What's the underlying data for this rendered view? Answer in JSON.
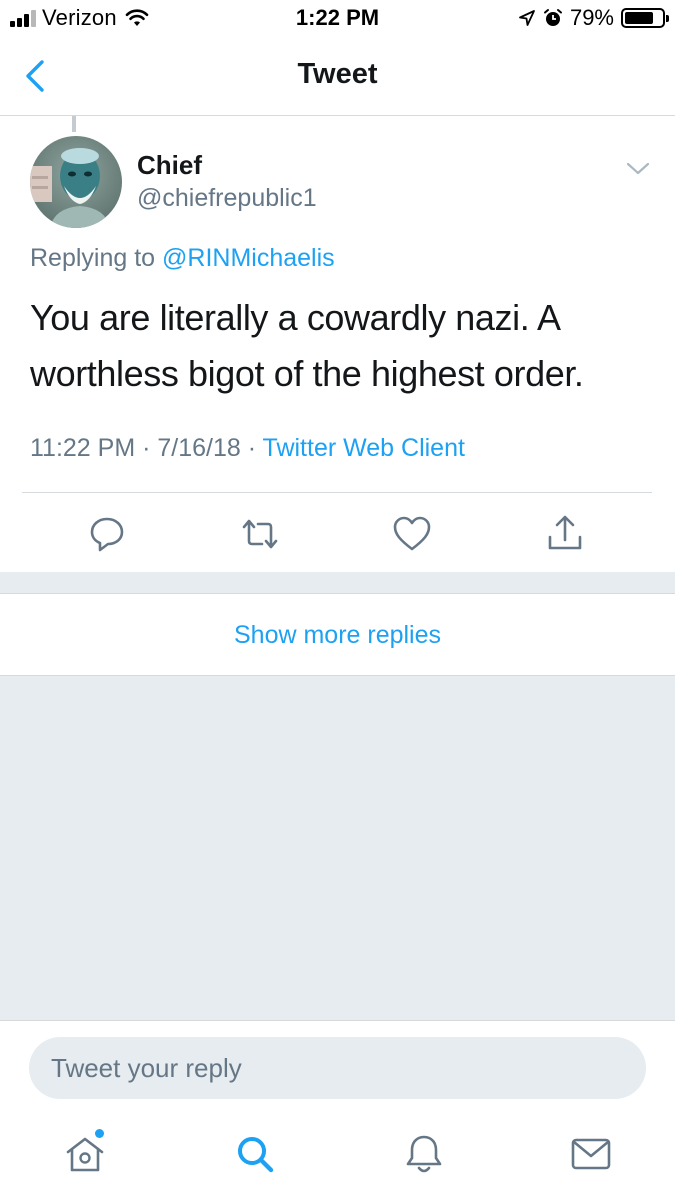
{
  "status_bar": {
    "carrier": "Verizon",
    "time": "1:22 PM",
    "battery_percent_text": "79%",
    "battery_level": 0.79,
    "signal_bars_filled": 3,
    "signal_bars_total": 4
  },
  "nav": {
    "title": "Tweet"
  },
  "tweet": {
    "author_name": "Chief",
    "author_handle": "@chiefrepublic1",
    "replying_to_prefix": "Replying to ",
    "replying_to_handle": "@RINMichaelis",
    "text": "You are literally a cowardly nazi. A worthless bigot of the highest order.",
    "timestamp": "11:22 PM · 7/16/18 · ",
    "client": "Twitter Web Client"
  },
  "actions": [
    {
      "name": "reply",
      "icon": "reply-icon"
    },
    {
      "name": "retweet",
      "icon": "retweet-icon"
    },
    {
      "name": "like",
      "icon": "heart-icon"
    },
    {
      "name": "share",
      "icon": "share-icon"
    }
  ],
  "replies": {
    "show_more_label": "Show more replies"
  },
  "composer": {
    "placeholder": "Tweet your reply"
  },
  "tabbar": [
    {
      "name": "home",
      "icon": "home-icon",
      "has_notification_dot": true
    },
    {
      "name": "search",
      "icon": "search-icon",
      "active": true
    },
    {
      "name": "notifications",
      "icon": "bell-icon"
    },
    {
      "name": "messages",
      "icon": "mail-icon"
    }
  ],
  "colors": {
    "accent": "#1da1f2",
    "secondary_text": "#657786",
    "primary_text": "#14171a",
    "background_gray": "#e6ecf0",
    "divider": "#d6dadd",
    "icon_gray": "#657786"
  }
}
